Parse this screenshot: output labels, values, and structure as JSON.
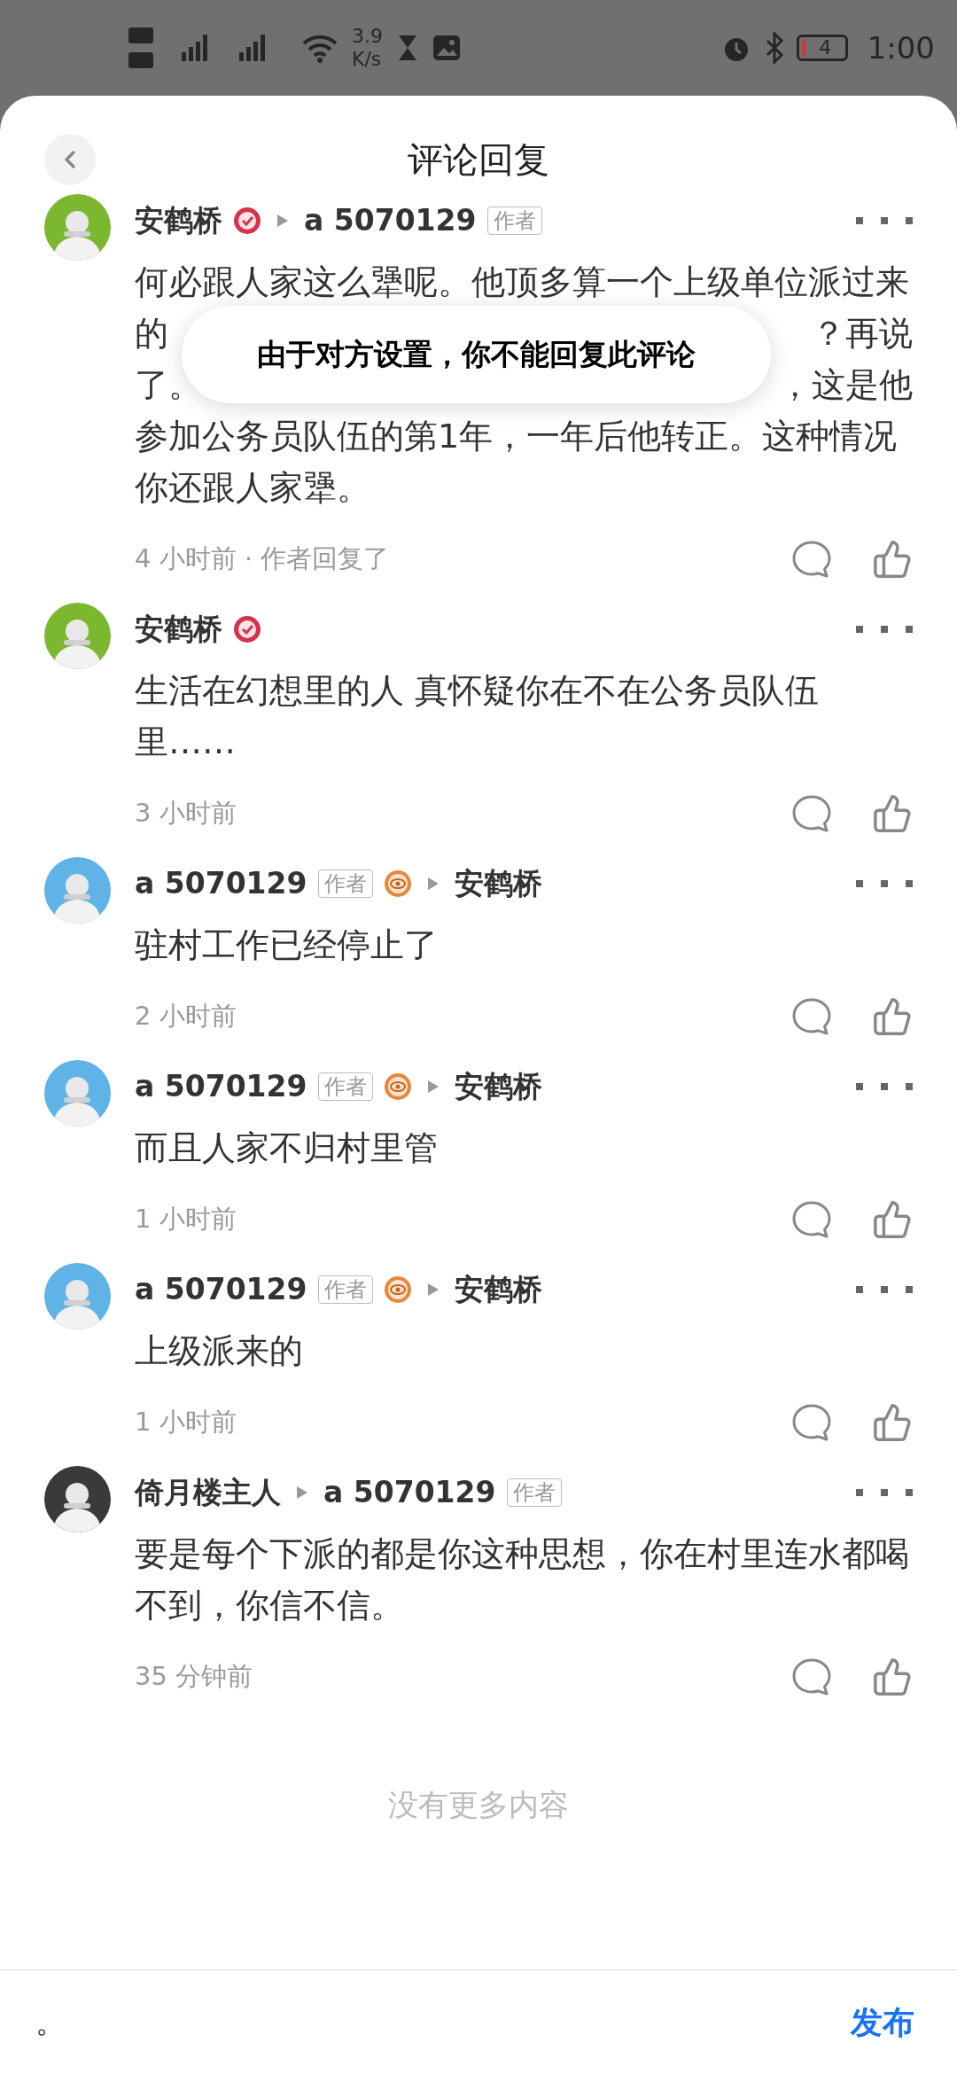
{
  "status_bar": {
    "network_speed": "3.9",
    "speed_unit": "K/s",
    "battery": "4",
    "time": "1:00"
  },
  "header": {
    "title": "评论回复"
  },
  "toast": "由于对方设置，你不能回复此评论",
  "comments": [
    {
      "avatar": {
        "kind": "picture",
        "color": "#7cb82f"
      },
      "author": {
        "name": "安鹤桥",
        "kind": "verified"
      },
      "reply_to": {
        "name": "a 5070129",
        "tag": "作者"
      },
      "lines": [
        [
          "何必跟人家这么犟呢。他顶多算一个上级单位派过来"
        ],
        [
          "的",
          "？再说"
        ],
        [
          "了。",
          "，这是他"
        ],
        [
          "参加公务员队伍的第1年，一年后他转正。这种情况"
        ],
        [
          "你还跟人家犟。"
        ]
      ],
      "meta": "4 小时前 · 作者回复了"
    },
    {
      "avatar": {
        "kind": "picture",
        "color": "#7cb82f"
      },
      "author": {
        "name": "安鹤桥",
        "kind": "verified"
      },
      "body": "生活在幻想里的人 真怀疑你在不在公务员队伍里……",
      "meta": "3 小时前"
    },
    {
      "avatar": {
        "kind": "picture",
        "color": "#5fb3e6"
      },
      "author": {
        "name": "a 5070129",
        "tag": "作者",
        "kind": "eye"
      },
      "reply_to": {
        "name": "安鹤桥"
      },
      "body": "驻村工作已经停止了",
      "meta": "2 小时前"
    },
    {
      "avatar": {
        "kind": "picture",
        "color": "#5fb3e6"
      },
      "author": {
        "name": "a 5070129",
        "tag": "作者",
        "kind": "eye"
      },
      "reply_to": {
        "name": "安鹤桥"
      },
      "body": "而且人家不归村里管",
      "meta": "1 小时前"
    },
    {
      "avatar": {
        "kind": "picture",
        "color": "#5fb3e6"
      },
      "author": {
        "name": "a 5070129",
        "tag": "作者",
        "kind": "eye"
      },
      "reply_to": {
        "name": "安鹤桥"
      },
      "body": "上级派来的",
      "meta": "1 小时前"
    },
    {
      "avatar": {
        "kind": "picture",
        "color": "#3a3a3a"
      },
      "author": {
        "name": "倚月楼主人"
      },
      "reply_to": {
        "name": "a 5070129",
        "tag": "作者"
      },
      "body": "要是每个下派的都是你这种思想，你在村里连水都喝不到，你信不信。",
      "meta": "35 分钟前"
    }
  ],
  "end_note": "没有更多内容",
  "composer": {
    "value": "。",
    "send": "发布"
  }
}
